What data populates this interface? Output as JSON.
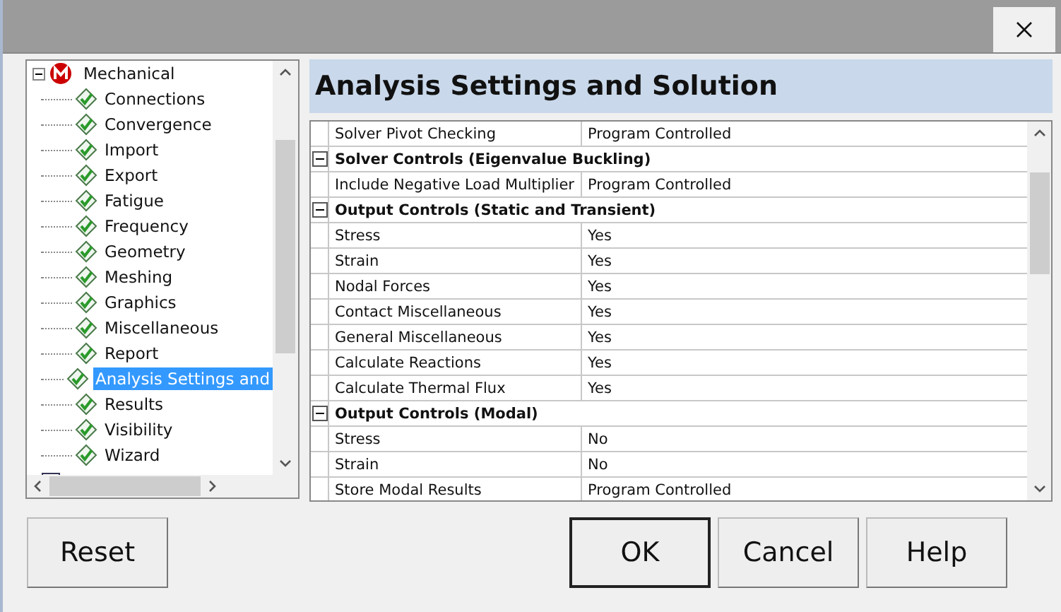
{
  "tree": {
    "label": "Mechanical",
    "expanded": true,
    "children": [
      {
        "label": "Connections",
        "selected": false
      },
      {
        "label": "Convergence",
        "selected": false
      },
      {
        "label": "Import",
        "selected": false
      },
      {
        "label": "Export",
        "selected": false
      },
      {
        "label": "Fatigue",
        "selected": false
      },
      {
        "label": "Frequency",
        "selected": false
      },
      {
        "label": "Geometry",
        "selected": false
      },
      {
        "label": "Meshing",
        "selected": false
      },
      {
        "label": "Graphics",
        "selected": false
      },
      {
        "label": "Miscellaneous",
        "selected": false
      },
      {
        "label": "Report",
        "selected": false
      },
      {
        "label": "Analysis Settings and",
        "selected": true
      },
      {
        "label": "Results",
        "selected": false
      },
      {
        "label": "Visibility",
        "selected": false
      },
      {
        "label": "Wizard",
        "selected": false
      }
    ]
  },
  "panel": {
    "title": "Analysis Settings and Solution"
  },
  "grid": {
    "rows": [
      {
        "kind": "property",
        "name": "Solver Pivot Checking",
        "value": "Program Controlled"
      },
      {
        "kind": "category",
        "name": "Solver Controls (Eigenvalue Buckling)",
        "expanded": true
      },
      {
        "kind": "property",
        "name": "Include Negative Load Multiplier",
        "value": "Program Controlled"
      },
      {
        "kind": "category",
        "name": "Output Controls (Static and Transient)",
        "expanded": true
      },
      {
        "kind": "property",
        "name": "Stress",
        "value": "Yes"
      },
      {
        "kind": "property",
        "name": "Strain",
        "value": "Yes"
      },
      {
        "kind": "property",
        "name": "Nodal Forces",
        "value": "Yes"
      },
      {
        "kind": "property",
        "name": "Contact Miscellaneous",
        "value": "Yes"
      },
      {
        "kind": "property",
        "name": "General Miscellaneous",
        "value": "Yes"
      },
      {
        "kind": "property",
        "name": "Calculate Reactions",
        "value": "Yes"
      },
      {
        "kind": "property",
        "name": "Calculate Thermal Flux",
        "value": "Yes"
      },
      {
        "kind": "category",
        "name": "Output Controls (Modal)",
        "expanded": true
      },
      {
        "kind": "property",
        "name": "Stress",
        "value": "No"
      },
      {
        "kind": "property",
        "name": "Strain",
        "value": "No"
      },
      {
        "kind": "property",
        "name": "Store Modal Results",
        "value": "Program Controlled"
      }
    ]
  },
  "buttons": [
    {
      "label": "Reset",
      "default": false
    },
    {
      "label": "OK",
      "default": true
    },
    {
      "label": "Cancel",
      "default": false
    },
    {
      "label": "Help",
      "default": false
    }
  ]
}
